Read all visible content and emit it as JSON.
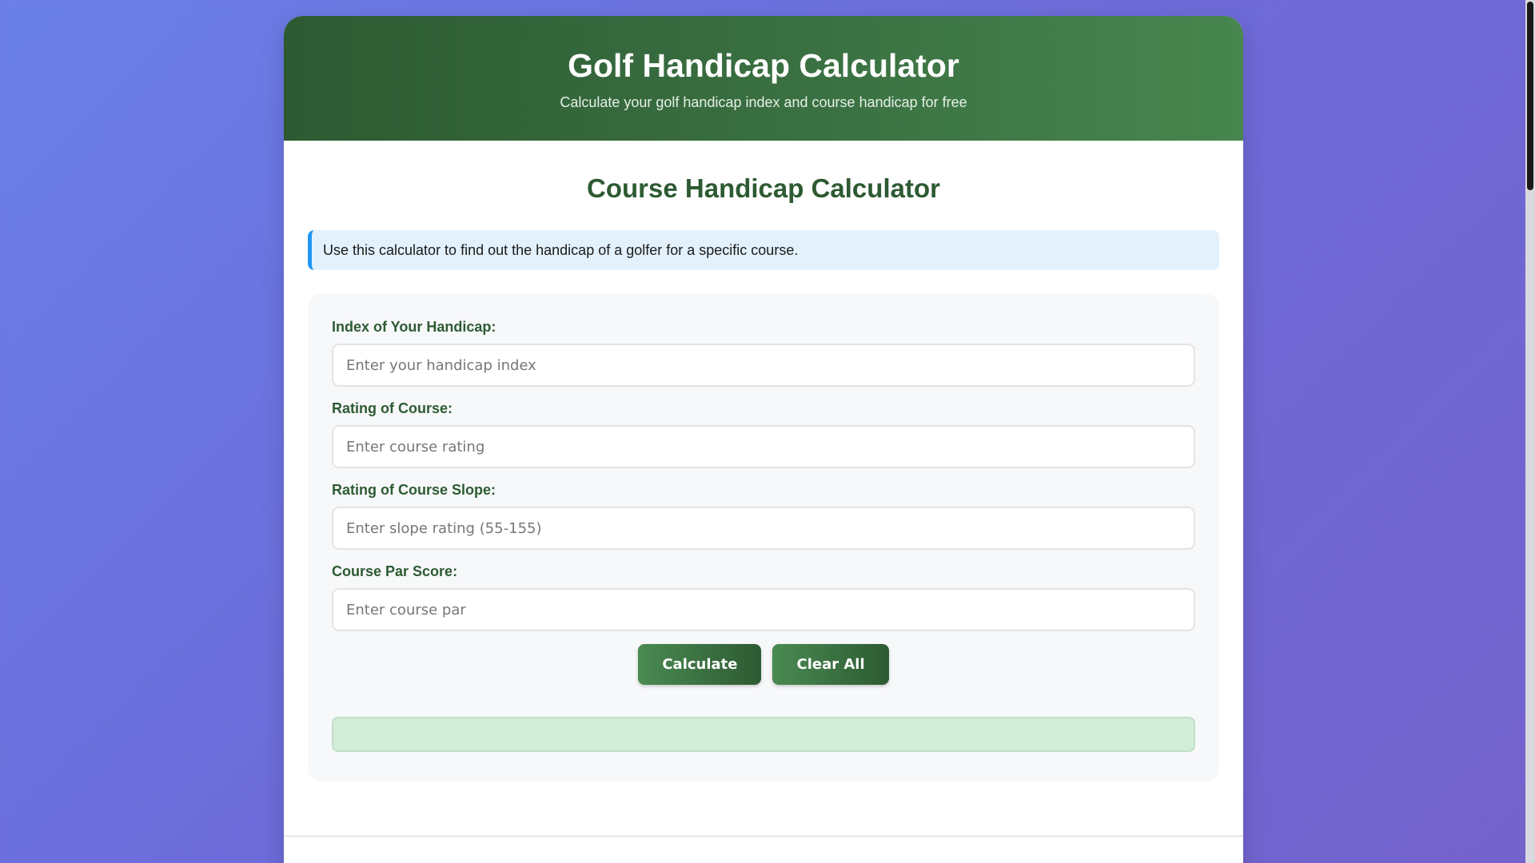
{
  "header": {
    "title": "Golf Handicap Calculator",
    "subtitle": "Calculate your golf handicap index and course handicap for free"
  },
  "main": {
    "section_title": "Course Handicap Calculator",
    "info_text": "Use this calculator to find out the handicap of a golfer for a specific course."
  },
  "form": {
    "fields": [
      {
        "label": "Index of Your Handicap:",
        "placeholder": "Enter your handicap index",
        "value": ""
      },
      {
        "label": "Rating of Course:",
        "placeholder": "Enter course rating",
        "value": ""
      },
      {
        "label": "Rating of Course Slope:",
        "placeholder": "Enter slope rating (55-155)",
        "value": ""
      },
      {
        "label": "Course Par Score:",
        "placeholder": "Enter course par",
        "value": ""
      }
    ],
    "calculate_label": "Calculate",
    "clear_label": "Clear All",
    "result_text": ""
  },
  "colors": {
    "brand_green": "#2d5a32",
    "accent_blue": "#2196f3",
    "result_bg": "#d4edd9"
  }
}
